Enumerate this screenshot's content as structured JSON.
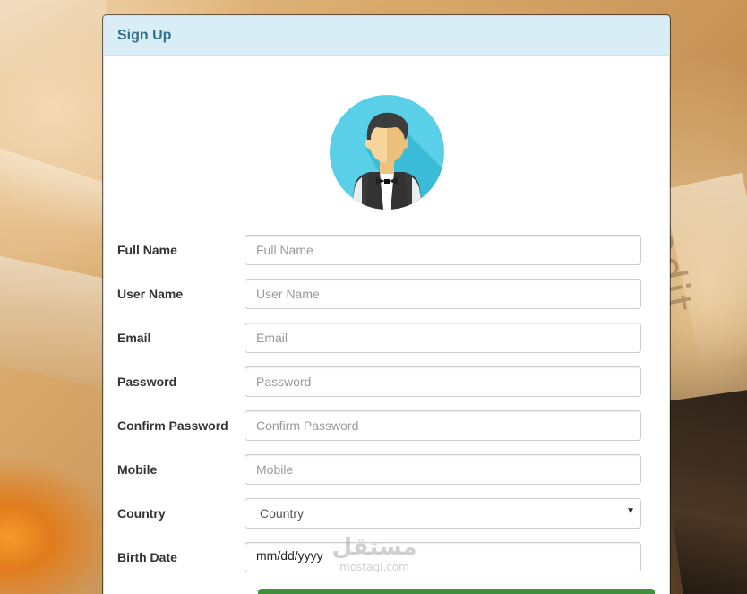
{
  "background": {
    "decorative_text": "edit"
  },
  "panel": {
    "title": "Sign Up",
    "heading_color": "#31708f",
    "heading_bg": "#d9edf7",
    "avatar_icon": "waiter-avatar-icon"
  },
  "form": {
    "fields": [
      {
        "label": "Full Name",
        "placeholder": "Full Name",
        "value": ""
      },
      {
        "label": "User Name",
        "placeholder": "User Name",
        "value": ""
      },
      {
        "label": "Email",
        "placeholder": "Email",
        "value": ""
      },
      {
        "label": "Password",
        "placeholder": "Password",
        "value": ""
      },
      {
        "label": "Confirm Password",
        "placeholder": "Confirm Password",
        "value": ""
      },
      {
        "label": "Mobile",
        "placeholder": "Mobile",
        "value": ""
      }
    ],
    "country": {
      "label": "Country",
      "selected": "Country",
      "arrow_icon": "caret-down-icon"
    },
    "birth_date": {
      "label": "Birth Date",
      "value": "mm/dd/yyyy"
    },
    "submit_color": "#3f8f3f"
  },
  "watermark": {
    "arabic": "مستقل",
    "latin": "mostaql.com"
  }
}
